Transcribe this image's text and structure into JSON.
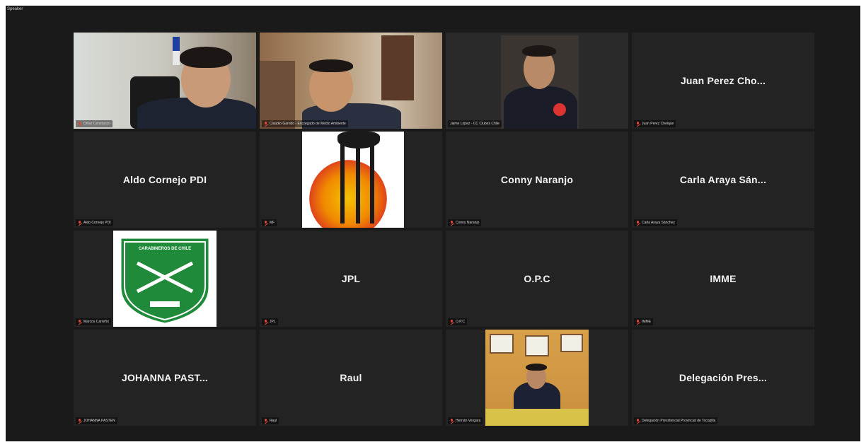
{
  "window": {
    "top_label": "Speaker"
  },
  "tiles": [
    {
      "label": "Omar Constanzo",
      "kind": "video"
    },
    {
      "label": "Claudio Garrido - Encargado de Medio Ambiente",
      "kind": "video"
    },
    {
      "label": "Jaime Lopez - CC Clubes Chile",
      "kind": "video",
      "active": true
    },
    {
      "name": "Juan Perez Cho...",
      "label": "Juan Perez Chelque"
    },
    {
      "name": "Aldo Cornejo PDI",
      "label": "Aldo Cornejo PDI"
    },
    {
      "label": "MF",
      "kind": "image"
    },
    {
      "name": "Conny Naranjo",
      "label": "Conny Naranjo"
    },
    {
      "name": "Carla Araya Sán...",
      "label": "Carla Araya Sánchez"
    },
    {
      "label": "Marcos Carreño",
      "kind": "image"
    },
    {
      "name": "JPL",
      "label": "JPL"
    },
    {
      "name": "O.P.C",
      "label": "O.P.C"
    },
    {
      "name": "IMME",
      "label": "IMME"
    },
    {
      "name": "JOHANNA  PAST...",
      "label": "JOHANNA PASTEN"
    },
    {
      "name": "Raul",
      "label": "Raul"
    },
    {
      "label": "Hernán Vergara",
      "kind": "video"
    },
    {
      "name": "Delegación  Pres...",
      "label": "Delegación Presidencial Provincial de Tocopilla"
    }
  ],
  "shield": {
    "title": "CARABINEROS DE CHILE"
  },
  "colors": {
    "active_border": "#c8d36a",
    "tile_bg": "#232323",
    "muted_mic": "#e0453a"
  }
}
